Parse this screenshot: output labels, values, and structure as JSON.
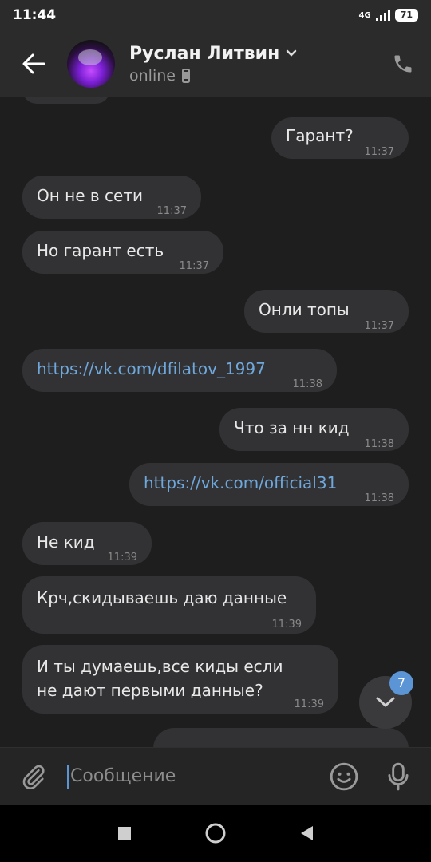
{
  "status_bar": {
    "time": "11:44",
    "network": "4G",
    "battery": "71"
  },
  "header": {
    "name": "Руслан Литвин",
    "status": "online"
  },
  "messages": [
    {
      "side": "out",
      "text": "Гарант?",
      "time": "11:37"
    },
    {
      "side": "in",
      "text": "Он не в сети",
      "time": "11:37"
    },
    {
      "side": "in",
      "text": "Но гарант есть",
      "time": "11:37"
    },
    {
      "side": "out",
      "text": "Онли топы",
      "time": "11:37"
    },
    {
      "side": "in",
      "text": "https://vk.com/dfilatov_1997",
      "time": "11:38",
      "link": true
    },
    {
      "side": "out",
      "text": "Что за нн кид",
      "time": "11:38"
    },
    {
      "side": "out",
      "text": "https://vk.com/official31",
      "time": "11:38",
      "link": true
    },
    {
      "side": "in",
      "text": "Не кид",
      "time": "11:39"
    },
    {
      "side": "in",
      "text": "Крч,скидываешь даю данные",
      "time": "11:39"
    },
    {
      "side": "in",
      "text": "И ты думаешь,все киды если не дают первыми данные?",
      "time": "11:39"
    }
  ],
  "scroll_badge": "7",
  "composer": {
    "placeholder": "Сообщение"
  },
  "icons": {
    "back": "arrow-left-icon",
    "phone": "phone-icon",
    "attach": "paperclip-icon",
    "emoji": "smile-icon",
    "mic": "microphone-icon",
    "scroll": "chevron-down-icon"
  },
  "colors": {
    "accent": "#5c95d6",
    "bubble": "#323234",
    "background": "#1e1e1f"
  }
}
